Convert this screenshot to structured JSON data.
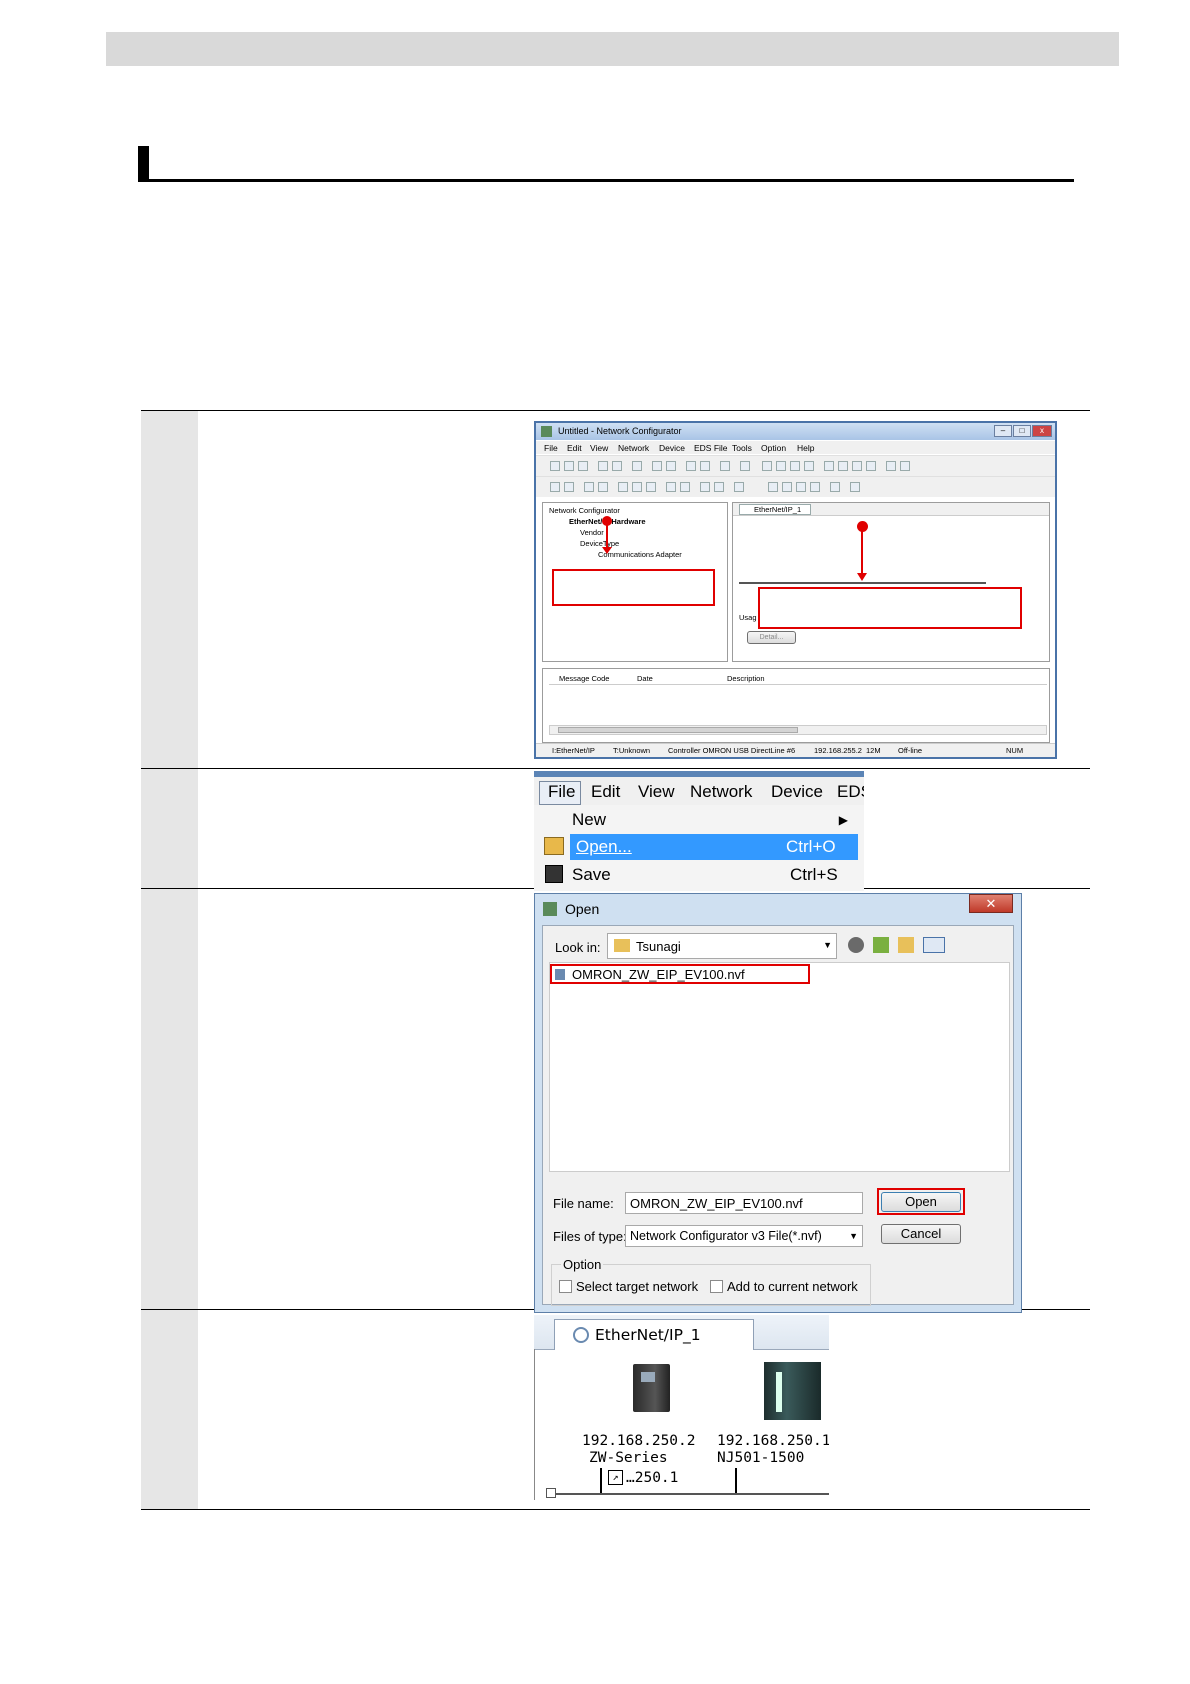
{
  "networkConfigurator": {
    "title": "Untitled - Network Configurator",
    "menu": [
      "File",
      "Edit",
      "View",
      "Network",
      "Device",
      "EDS File",
      "Tools",
      "Option",
      "Help"
    ],
    "tree": {
      "root": "Network Configurator",
      "hardware": "EtherNet/IP Hardware",
      "vendor": "Vendor",
      "deviceType": "DeviceType",
      "adapter": "Communications Adapter"
    },
    "networkTab": "EtherNet/IP_1",
    "usageLabel": "Usag",
    "detailButton": "Detail...",
    "messageColumns": [
      "Message Code",
      "Date",
      "Description"
    ],
    "status": {
      "network": "I:EtherNet/IP",
      "target": "T:Unknown",
      "controller": "Controller OMRON USB DirectLine #6",
      "address": "192.168.255.2",
      "speed": "12M",
      "mode": "Off-line",
      "num": "NUM"
    }
  },
  "fileMenu": {
    "bar": [
      "File",
      "Edit",
      "View",
      "Network",
      "Device",
      "EDS"
    ],
    "items": [
      {
        "label": "New",
        "shortcut": ""
      },
      {
        "label": "Open...",
        "shortcut": "Ctrl+O"
      },
      {
        "label": "Save",
        "shortcut": "Ctrl+S"
      }
    ]
  },
  "openDialog": {
    "title": "Open",
    "lookInLabel": "Look in:",
    "lookInValue": "Tsunagi",
    "fileItem": "OMRON_ZW_EIP_EV100.nvf",
    "fileNameLabel": "File name:",
    "fileNameValue": "OMRON_ZW_EIP_EV100.nvf",
    "fileTypeLabel": "Files of type:",
    "fileTypeValue": "Network Configurator v3 File(*.nvf)",
    "openButton": "Open",
    "cancelButton": "Cancel",
    "optionLabel": "Option",
    "selectTarget": "Select target network",
    "addCurrent": "Add to current network"
  },
  "networkView": {
    "tab": "EtherNet/IP_1",
    "device1": {
      "ip": "192.168.250.2",
      "name": "ZW-Series",
      "link": "…250.1"
    },
    "device2": {
      "ip": "192.168.250.1",
      "name": "NJ501-1500"
    }
  }
}
